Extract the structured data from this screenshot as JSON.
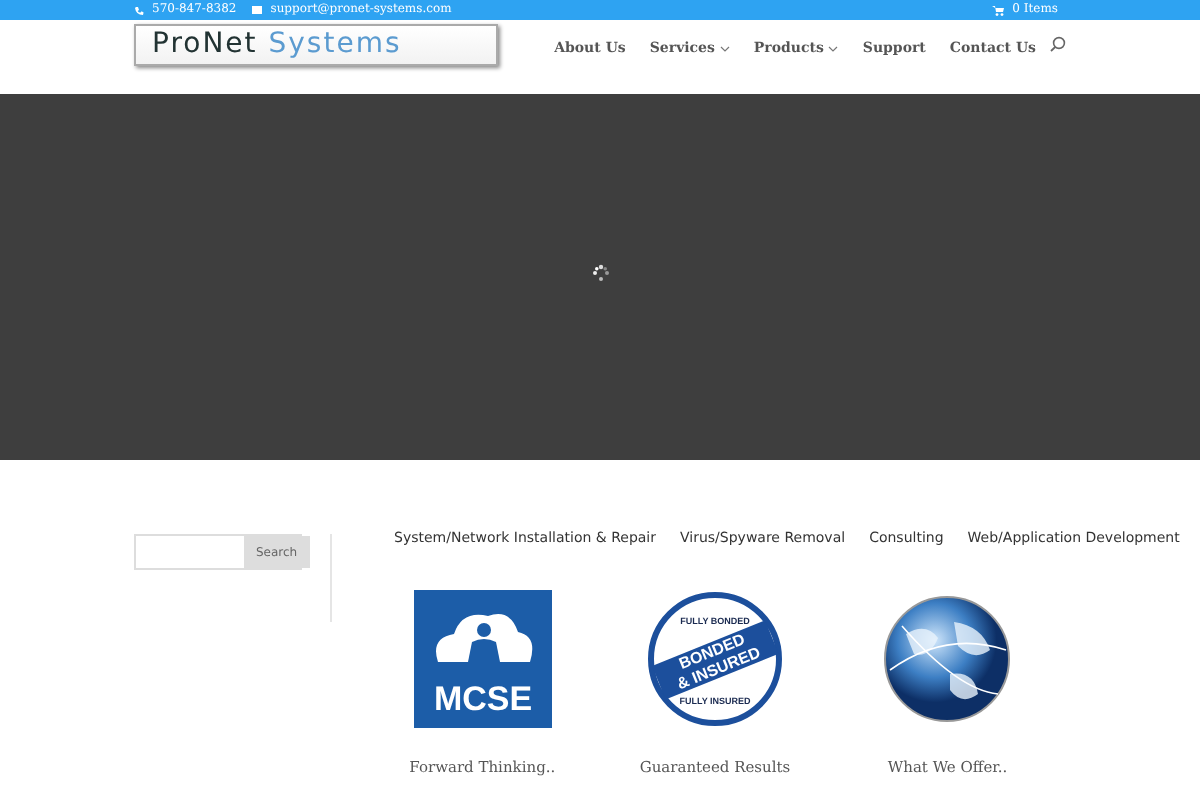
{
  "top_bar": {
    "phone": "570-847-8382",
    "email": "support@pronet-systems.com",
    "cart": "0 Items"
  },
  "logo": {
    "first": "ProNet",
    "second": "Systems"
  },
  "nav": [
    {
      "label": "About Us",
      "has_menu": false
    },
    {
      "label": "Services",
      "has_menu": true
    },
    {
      "label": "Products",
      "has_menu": true
    },
    {
      "label": "Support",
      "has_menu": false
    },
    {
      "label": "Contact Us",
      "has_menu": false
    }
  ],
  "hero": {
    "loading": true
  },
  "sidebar": {
    "search_button": "Search"
  },
  "services": [
    "System/Network Installation & Repair",
    "Virus/Spyware Removal",
    "Consulting",
    "Web/Application Development"
  ],
  "features": [
    {
      "kind": "mcse",
      "badge_text": "MCSE",
      "title": "Forward Thinking.."
    },
    {
      "kind": "bonded",
      "badge_text": [
        "FULLY BONDED",
        "BONDED",
        "& INSURED",
        "FULLY INSURED"
      ],
      "title": "Guaranteed Results"
    },
    {
      "kind": "globe",
      "title": "What We Offer.."
    }
  ]
}
